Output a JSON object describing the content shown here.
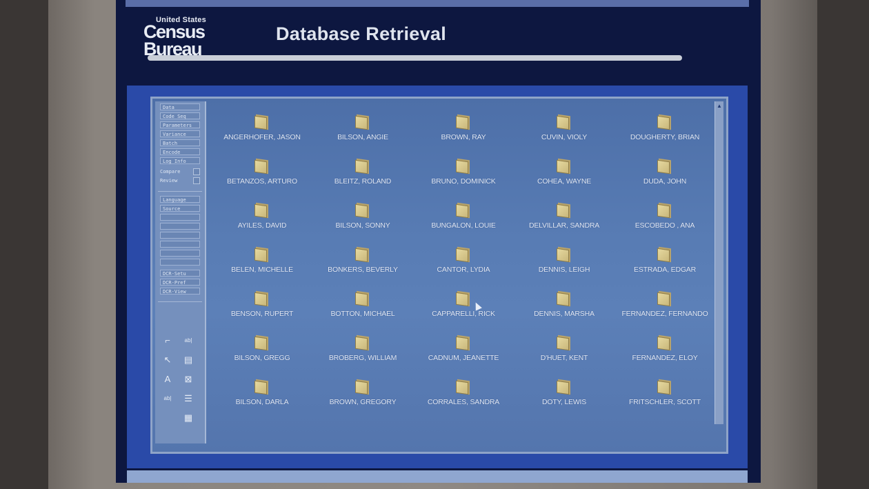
{
  "header": {
    "logo_small": "United States",
    "logo_line1": "Census",
    "logo_line2": "Bureau",
    "title": "Database Retrieval"
  },
  "toolpanel": {
    "buttons": [
      "Data",
      "Code Seq",
      "Parameters",
      "Variance",
      "Batch",
      "Encode",
      "Log Info"
    ],
    "checks": [
      "Compare",
      "Review"
    ],
    "buttons2": [
      "Language",
      "Source",
      "",
      "",
      "",
      "",
      "",
      ""
    ],
    "buttons3": [
      "DCR-Setu",
      "DCR-Pref",
      "DCR-View"
    ],
    "icons": [
      "select-icon",
      "text-field-icon",
      "pointer-icon",
      "list-icon",
      "text-tool-icon",
      "close-box-icon",
      "label-icon",
      "menu-icon",
      "table-icon"
    ]
  },
  "records": [
    "ANGERHOFER, JASON",
    "BETANZOS, ARTURO",
    "AYILES, DAVID",
    "BELEN, MICHELLE",
    "BENSON, RUPERT",
    "BILSON, GREGG",
    "BILSON, DARLA",
    "BILSON, ANGIE",
    "BLEITZ, ROLAND",
    "BILSON, SONNY",
    "BONKERS, BEVERLY",
    "BOTTON, MICHAEL",
    "BROBERG, WILLIAM",
    "BROWN, GREGORY",
    "BROWN, RAY",
    "BRUNO, DOMINICK",
    "BUNGALON, LOUIE",
    "CANTOR, LYDIA",
    "CAPPARELLI, RICK",
    "CADNUM, JEANETTE",
    "CORRALES, SANDRA",
    "CUVIN, VIOLY",
    "COHEA, WAYNE",
    "DELVILLAR, SANDRA",
    "DENNIS, LEIGH",
    "DENNIS, MARSHA",
    "D'HUET, KENT",
    "DOTY, LEWIS",
    "DOUGHERTY, BRIAN",
    "DUDA, JOHN",
    "ESCOBEDO , ANA",
    "ESTRADA, EDGAR",
    "FERNANDEZ, FERNANDO",
    "FERNANDEZ, ELOY",
    "FRITSCHLER, SCOTT"
  ]
}
